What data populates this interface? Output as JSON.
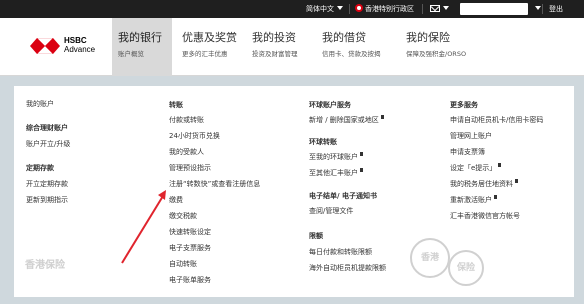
{
  "topbar": {
    "language": "简体中文",
    "region": "香港特别行政区",
    "logout": "登出"
  },
  "logo": {
    "brand": "HSBC",
    "sub": "Advance"
  },
  "nav": [
    {
      "title": "我的银行",
      "sub": "账户概览"
    },
    {
      "title": "优惠及奖赏",
      "sub": "更多的汇丰优惠"
    },
    {
      "title": "我的投资",
      "sub": "投资及财富管理"
    },
    {
      "title": "我的借贷",
      "sub": "信用卡、贷款及按揭"
    },
    {
      "title": "我的保险",
      "sub": "保障及强积金/ORSO"
    }
  ],
  "menu": {
    "col1": {
      "link0": "我的账户",
      "h1": "综合理财账户",
      "l1": "账户开立/升级",
      "h2": "定期存款",
      "l2a": "开立定期存款",
      "l2b": "更新到期指示"
    },
    "col2": {
      "h": "转账",
      "items": [
        "付款或转账",
        "24小时货币兑换",
        "我的受款人",
        "管理预设指示",
        "注册“转数快”或查看注册信息",
        "缴费",
        "缴交税款",
        "快速转账设定",
        "电子支票服务",
        "自动转账",
        "电子账单服务"
      ]
    },
    "col3": {
      "h1": "环球账户服务",
      "l1": "新增 / 删除国家或地区",
      "h2": "环球转账",
      "l2a": "至我的环球账户",
      "l2b": "至其他汇丰账户",
      "h3": "电子结单/ 电子通知书",
      "l3": "查阅/管理文件",
      "h4": "限额",
      "l4a": "每日付款和转账限额",
      "l4b": "海外自动柜员机提款限额"
    },
    "col4": {
      "h": "更多服务",
      "items": [
        "申请自动柜员机卡/信用卡密码",
        "管理网上账户",
        "申请支票簿",
        "设定「e提示」",
        "我的税务居住地资料",
        "重新激活账户",
        "汇丰香港微信官方帐号"
      ]
    }
  },
  "watermark": {
    "text1": "香港保险",
    "text2": "香港",
    "text3": "保险"
  }
}
